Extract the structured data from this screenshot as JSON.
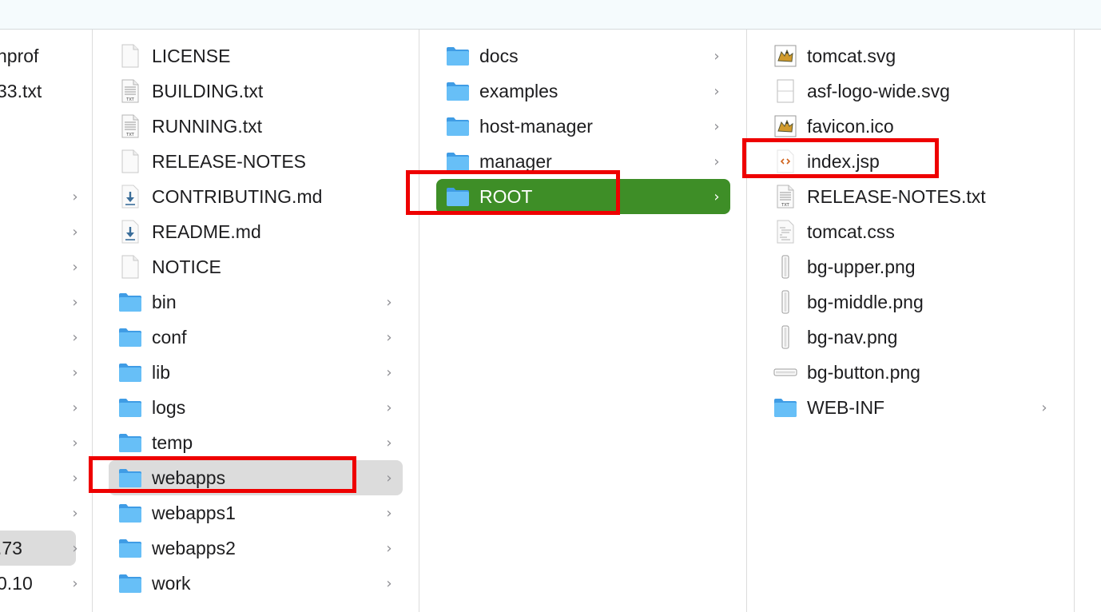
{
  "columns": {
    "col0": {
      "items": [
        {
          "label": "nprof",
          "has_children": false,
          "selected": false
        },
        {
          "label": "33.txt",
          "has_children": false,
          "selected": false
        },
        {
          "label": "",
          "has_children": false,
          "selected": false
        },
        {
          "label": "",
          "has_children": false,
          "selected": false
        },
        {
          "label": "",
          "has_children": true,
          "selected": false
        },
        {
          "label": "",
          "has_children": true,
          "selected": false
        },
        {
          "label": "",
          "has_children": true,
          "selected": false
        },
        {
          "label": "",
          "has_children": true,
          "selected": false
        },
        {
          "label": "",
          "has_children": true,
          "selected": false
        },
        {
          "label": "",
          "has_children": true,
          "selected": false
        },
        {
          "label": "",
          "has_children": true,
          "selected": false
        },
        {
          "label": "",
          "has_children": true,
          "selected": false
        },
        {
          "label": "",
          "has_children": true,
          "selected": false
        },
        {
          "label": "",
          "has_children": true,
          "selected": false
        },
        {
          "label": ".73",
          "has_children": true,
          "selected": true
        },
        {
          "label": "0.10",
          "has_children": true,
          "selected": false
        }
      ]
    },
    "col1": {
      "items": [
        {
          "label": "LICENSE",
          "icon": "blank-document-icon",
          "has_children": false
        },
        {
          "label": "BUILDING.txt",
          "icon": "text-document-icon",
          "has_children": false
        },
        {
          "label": "RUNNING.txt",
          "icon": "text-document-icon",
          "has_children": false
        },
        {
          "label": "RELEASE-NOTES",
          "icon": "blank-document-icon",
          "has_children": false
        },
        {
          "label": "CONTRIBUTING.md",
          "icon": "markdown-document-icon",
          "has_children": false
        },
        {
          "label": "README.md",
          "icon": "markdown-document-icon",
          "has_children": false
        },
        {
          "label": "NOTICE",
          "icon": "blank-document-icon",
          "has_children": false
        },
        {
          "label": "bin",
          "icon": "folder-icon",
          "has_children": true
        },
        {
          "label": "conf",
          "icon": "folder-icon",
          "has_children": true
        },
        {
          "label": "lib",
          "icon": "folder-icon",
          "has_children": true
        },
        {
          "label": "logs",
          "icon": "folder-icon",
          "has_children": true
        },
        {
          "label": "temp",
          "icon": "folder-icon",
          "has_children": true
        },
        {
          "label": "webapps",
          "icon": "folder-icon",
          "has_children": true
        },
        {
          "label": "webapps1",
          "icon": "folder-icon",
          "has_children": true
        },
        {
          "label": "webapps2",
          "icon": "folder-icon",
          "has_children": true
        },
        {
          "label": "work",
          "icon": "folder-icon",
          "has_children": true
        }
      ]
    },
    "col2": {
      "items": [
        {
          "label": "docs",
          "icon": "folder-icon",
          "has_children": true
        },
        {
          "label": "examples",
          "icon": "folder-icon",
          "has_children": true
        },
        {
          "label": "host-manager",
          "icon": "folder-icon",
          "has_children": true
        },
        {
          "label": "manager",
          "icon": "folder-icon",
          "has_children": true
        },
        {
          "label": "ROOT",
          "icon": "folder-icon",
          "has_children": true
        }
      ]
    },
    "col3": {
      "items": [
        {
          "label": "tomcat.svg",
          "icon": "tomcat-image-icon",
          "has_children": false
        },
        {
          "label": "asf-logo-wide.svg",
          "icon": "svg-document-icon",
          "has_children": false
        },
        {
          "label": "favicon.ico",
          "icon": "tomcat-image-icon",
          "has_children": false
        },
        {
          "label": "index.jsp",
          "icon": "code-document-icon",
          "has_children": false
        },
        {
          "label": "RELEASE-NOTES.txt",
          "icon": "text-document-icon",
          "has_children": false
        },
        {
          "label": "tomcat.css",
          "icon": "css-document-icon",
          "has_children": false
        },
        {
          "label": "bg-upper.png",
          "icon": "thin-image-icon",
          "has_children": false
        },
        {
          "label": "bg-middle.png",
          "icon": "thin-image-icon",
          "has_children": false
        },
        {
          "label": "bg-nav.png",
          "icon": "thin-image-icon",
          "has_children": false
        },
        {
          "label": "bg-button.png",
          "icon": "wide-image-icon",
          "has_children": false
        },
        {
          "label": "WEB-INF",
          "icon": "folder-icon",
          "has_children": true
        }
      ]
    }
  },
  "selection": {
    "col1_selected": "webapps",
    "col2_active": "ROOT",
    "col3_highlighted": "index.jsp"
  },
  "colors": {
    "active_row": "#3e8e27",
    "selected_row": "#dcdcdc",
    "highlight_box": "#ee0000",
    "folder": "#4aa8ec"
  }
}
